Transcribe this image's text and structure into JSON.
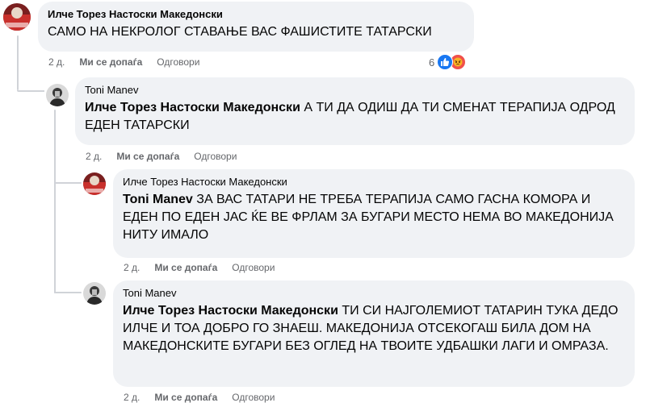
{
  "colors": {
    "bubble_bg": "#f0f2f5",
    "meta_text": "#65676b",
    "thread_line": "#d0d3d8",
    "like_blue": "#1877f2",
    "angry_red": "#f0504b"
  },
  "comments": [
    {
      "author": "Илче Торез Настоски Македонски",
      "mention": "",
      "text": "САМО НА НЕКРОЛОГ СТАВАЊЕ ВАС ФАШИСТИТЕ ТАТАРСКИ",
      "time": "2 д.",
      "like_label": "Ми се допаѓа",
      "reply_label": "Одговори",
      "reaction_count": "6",
      "reaction_icons": [
        "like-icon",
        "angry-icon"
      ]
    },
    {
      "author": "Toni Manev",
      "mention": "Илче Торез Настоски Македонски",
      "text": " А ТИ ДА ОДИШ ДА ТИ СМЕНАТ ТЕРАПИЈА ОДРОД ЕДЕН ТАТАРСКИ",
      "time": "2 д.",
      "like_label": "Ми се допаѓа",
      "reply_label": "Одговори"
    },
    {
      "author": "Илче Торез Настоски Македонски",
      "mention": "Toni Manev",
      "text": " ЗА ВАС ТАТАРИ НЕ ТРЕБА ТЕРАПИЈА САМО ГАСНА КОМОРА И ЕДЕН ПО ЕДЕН ЈАС ЌЕ ВЕ ФРЛАМ ЗА БУГАРИ МЕСТО НЕМА ВО МАКЕДОНИЈА НИТУ ИМАЛО",
      "time": "2 д.",
      "like_label": "Ми се допаѓа",
      "reply_label": "Одговори"
    },
    {
      "author": "Toni Manev",
      "mention": "Илче Торез Настоски Македонски",
      "text": " ТИ СИ НАЈГОЛЕМИОТ ТАТАРИН ТУКА ДЕДО ИЛЧЕ И ТОА ДОБРО ГО ЗНАЕШ. МАКЕДОНИЈА ОТСЕКОГАШ БИЛА ДОМ НА МАКЕДОНСКИТЕ БУГАРИ БЕЗ ОГЛЕД НА ТВОИТЕ УДБАШКИ ЛАГИ И ОМРАЗА.",
      "time": "2 д.",
      "like_label": "Ми се допаѓа",
      "reply_label": "Одговори"
    }
  ]
}
